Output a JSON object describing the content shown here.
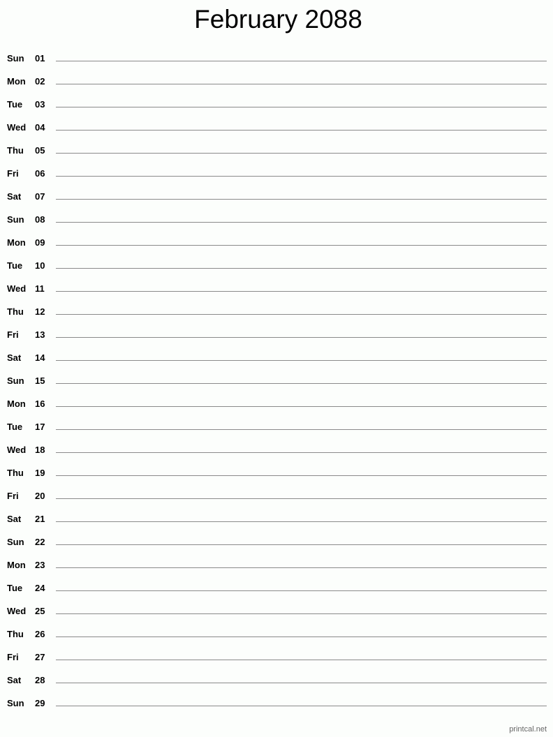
{
  "title": "February 2088",
  "days": [
    {
      "dow": "Sun",
      "num": "01"
    },
    {
      "dow": "Mon",
      "num": "02"
    },
    {
      "dow": "Tue",
      "num": "03"
    },
    {
      "dow": "Wed",
      "num": "04"
    },
    {
      "dow": "Thu",
      "num": "05"
    },
    {
      "dow": "Fri",
      "num": "06"
    },
    {
      "dow": "Sat",
      "num": "07"
    },
    {
      "dow": "Sun",
      "num": "08"
    },
    {
      "dow": "Mon",
      "num": "09"
    },
    {
      "dow": "Tue",
      "num": "10"
    },
    {
      "dow": "Wed",
      "num": "11"
    },
    {
      "dow": "Thu",
      "num": "12"
    },
    {
      "dow": "Fri",
      "num": "13"
    },
    {
      "dow": "Sat",
      "num": "14"
    },
    {
      "dow": "Sun",
      "num": "15"
    },
    {
      "dow": "Mon",
      "num": "16"
    },
    {
      "dow": "Tue",
      "num": "17"
    },
    {
      "dow": "Wed",
      "num": "18"
    },
    {
      "dow": "Thu",
      "num": "19"
    },
    {
      "dow": "Fri",
      "num": "20"
    },
    {
      "dow": "Sat",
      "num": "21"
    },
    {
      "dow": "Sun",
      "num": "22"
    },
    {
      "dow": "Mon",
      "num": "23"
    },
    {
      "dow": "Tue",
      "num": "24"
    },
    {
      "dow": "Wed",
      "num": "25"
    },
    {
      "dow": "Thu",
      "num": "26"
    },
    {
      "dow": "Fri",
      "num": "27"
    },
    {
      "dow": "Sat",
      "num": "28"
    },
    {
      "dow": "Sun",
      "num": "29"
    }
  ],
  "footer": "printcal.net"
}
